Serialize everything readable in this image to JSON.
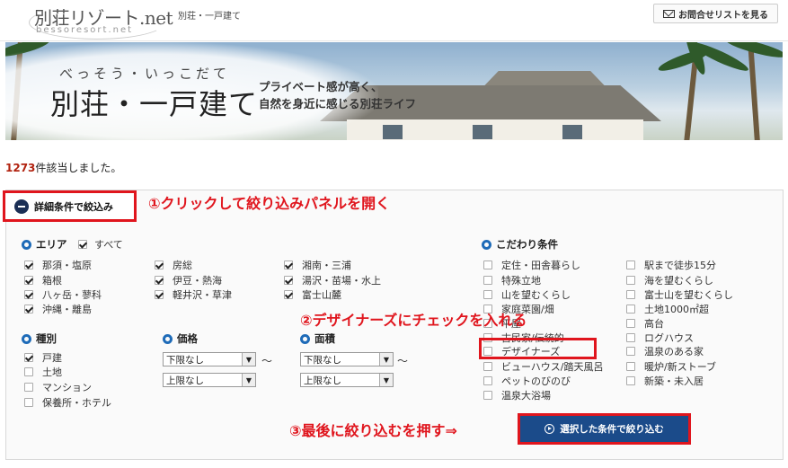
{
  "header": {
    "logo_main": "別荘リゾート.net",
    "logo_sub": "bessoresort.net",
    "breadcrumb": "別荘・一戸建て",
    "contact_label": "お問合せリストを見る"
  },
  "banner": {
    "subtitle": "べっそう・いっこだて",
    "title": "別荘・一戸建て",
    "desc_line1": "プライベート感が高く、",
    "desc_line2": "自然を身近に感じる別荘ライフ"
  },
  "result": {
    "count": "1273",
    "suffix": "件該当しました。"
  },
  "panel": {
    "toggle_label": "詳細条件で絞込み",
    "area": {
      "title": "エリア",
      "all_label": "すべて",
      "all_checked": true,
      "items": [
        {
          "label": "那須・塩原",
          "checked": true
        },
        {
          "label": "箱根",
          "checked": true
        },
        {
          "label": "八ヶ岳・蓼科",
          "checked": true
        },
        {
          "label": "沖縄・離島",
          "checked": true
        },
        {
          "label": "房総",
          "checked": true
        },
        {
          "label": "伊豆・熱海",
          "checked": true
        },
        {
          "label": "軽井沢・草津",
          "checked": true
        },
        {
          "label": "湘南・三浦",
          "checked": true
        },
        {
          "label": "湯沢・苗場・水上",
          "checked": true
        },
        {
          "label": "富士山麓",
          "checked": true
        }
      ]
    },
    "type": {
      "title": "種別",
      "items": [
        {
          "label": "戸建",
          "checked": true
        },
        {
          "label": "土地",
          "checked": false
        },
        {
          "label": "マンション",
          "checked": false
        },
        {
          "label": "保養所・ホテル",
          "checked": false
        }
      ]
    },
    "price": {
      "title": "価格",
      "min": "下限なし",
      "max": "上限なし",
      "tilde": "～"
    },
    "size": {
      "title": "面積",
      "min": "下限なし",
      "max": "上限なし",
      "tilde": "～"
    },
    "features": {
      "title": "こだわり条件",
      "col1": [
        {
          "label": "定住・田舎暮らし",
          "checked": false
        },
        {
          "label": "特殊立地",
          "checked": false
        },
        {
          "label": "山を望むくらし",
          "checked": false
        },
        {
          "label": "家庭菜園/畑",
          "checked": false
        },
        {
          "label": "平屋",
          "checked": false
        },
        {
          "label": "古民家/伝統的",
          "checked": false
        },
        {
          "label": "デザイナーズ",
          "checked": false
        },
        {
          "label": "ビューハウス/踏天風呂",
          "checked": false
        },
        {
          "label": "ペットのびのび",
          "checked": false
        },
        {
          "label": "温泉大浴場",
          "checked": false
        }
      ],
      "col2": [
        {
          "label": "駅まで徒歩15分",
          "checked": false
        },
        {
          "label": "海を望むくらし",
          "checked": false
        },
        {
          "label": "富士山を望むくらし",
          "checked": false
        },
        {
          "label": "土地1000㎡超",
          "checked": false
        },
        {
          "label": "高台",
          "checked": false
        },
        {
          "label": "ログハウス",
          "checked": false
        },
        {
          "label": "温泉のある家",
          "checked": false
        },
        {
          "label": "暖炉/新ストーブ",
          "checked": false
        },
        {
          "label": "新築・未入居",
          "checked": false
        }
      ]
    },
    "submit_label": "選択した条件で絞り込む"
  },
  "annotations": {
    "step1": "①クリックして絞り込みパネルを開く",
    "step2": "②デザイナーズにチェックを入れる",
    "step3": "③最後に絞り込むを押す⇒"
  },
  "colors": {
    "accent_red": "#e0151d",
    "navy": "#1b2f55",
    "button_blue": "#1b4b8a",
    "count_red": "#b1220f"
  }
}
